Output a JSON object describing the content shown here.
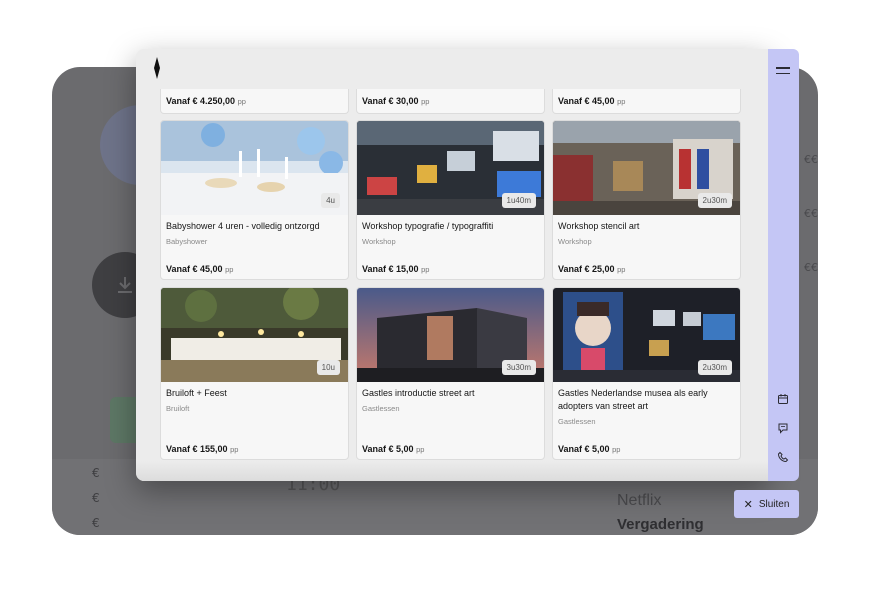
{
  "background": {
    "euro_symbols": [
      "€",
      "€",
      "€"
    ],
    "time": "11:00",
    "netflix": "Netflix",
    "meeting": "Vergadering",
    "right_symbols": [
      "€€",
      "€€",
      "€€"
    ]
  },
  "close_button": {
    "label": "Sluiten"
  },
  "top_row": [
    {
      "price": "Vanaf € 4.250,00",
      "unit": "pp"
    },
    {
      "price": "Vanaf € 30,00",
      "unit": "pp"
    },
    {
      "price": "Vanaf € 45,00",
      "unit": "pp"
    }
  ],
  "cards": [
    {
      "title": "Babyshower 4 uren - volledig ontzorgd",
      "category": "Babyshower",
      "duration": "4u",
      "price": "Vanaf € 45,00",
      "unit": "pp"
    },
    {
      "title": "Workshop typografie / typograffiti",
      "category": "Workshop",
      "duration": "1u40m",
      "price": "Vanaf € 15,00",
      "unit": "pp"
    },
    {
      "title": "Workshop stencil art",
      "category": "Workshop",
      "duration": "2u30m",
      "price": "Vanaf € 25,00",
      "unit": "pp"
    },
    {
      "title": "Bruiloft + Feest",
      "category": "Bruiloft",
      "duration": "10u",
      "price": "Vanaf € 155,00",
      "unit": "pp"
    },
    {
      "title": "Gastles introductie street art",
      "category": "Gastlessen",
      "duration": "3u30m",
      "price": "Vanaf € 5,00",
      "unit": "pp"
    },
    {
      "title": "Gastles Nederlandse musea als early adopters van street art",
      "category": "Gastlessen",
      "duration": "2u30m",
      "price": "Vanaf € 5,00",
      "unit": "pp"
    }
  ],
  "colors": {
    "accent": "#c4c6f5",
    "modal_bg": "#ececec",
    "card_bg": "#f7f7f7"
  },
  "icons": [
    "logo-diamond-icon",
    "hamburger-menu-icon",
    "calendar-icon",
    "chat-icon",
    "phone-icon",
    "close-icon",
    "download-icon"
  ]
}
